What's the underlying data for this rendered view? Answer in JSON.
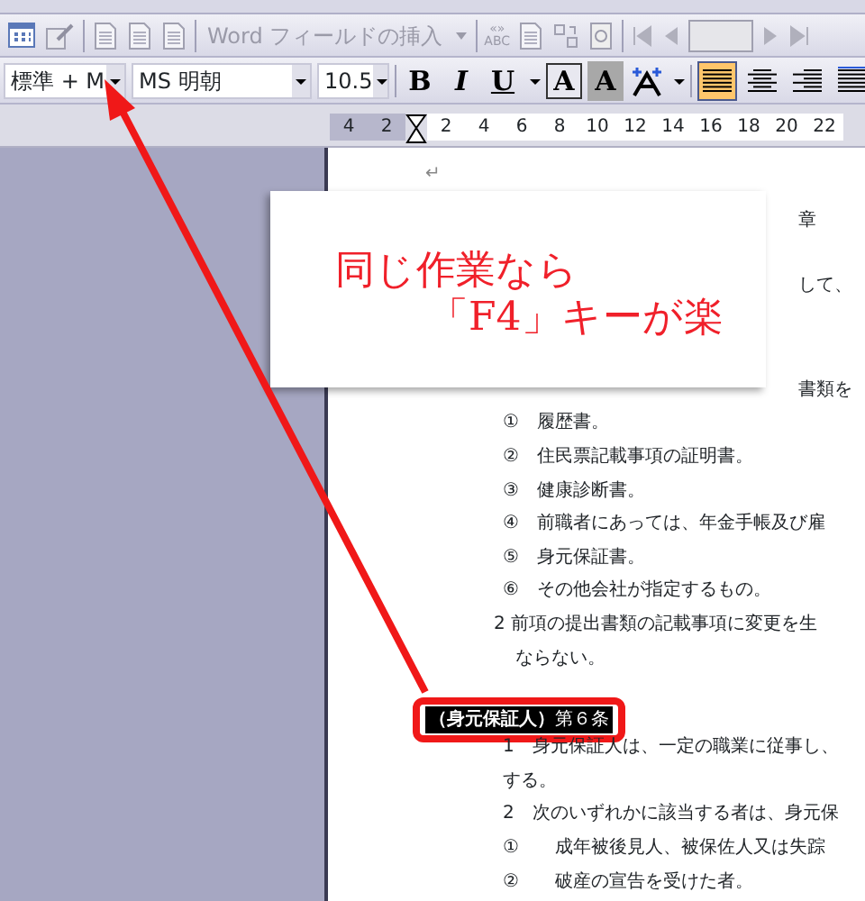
{
  "mail_merge_toolbar": {
    "field_menu": "Word フィールドの挿入",
    "merge_field_button": {
      "top": "«»",
      "bottom": "ABC"
    }
  },
  "formatting_toolbar": {
    "style": "標準 + M",
    "font": "MS 明朝",
    "size": "10.5",
    "format_buttons": [
      {
        "kind": "bold",
        "label": "B"
      },
      {
        "kind": "italic",
        "label": "I"
      },
      {
        "kind": "underline",
        "label": "U"
      },
      {
        "kind": "boxed",
        "label": "A"
      },
      {
        "kind": "shaded",
        "label": "A"
      }
    ],
    "alignment": [
      {
        "kind": "justify",
        "selected": true
      },
      {
        "kind": "center",
        "selected": false
      },
      {
        "kind": "right",
        "selected": false
      },
      {
        "kind": "distributed",
        "selected": false
      }
    ]
  },
  "ruler": {
    "left_labels": [
      "4",
      "2"
    ],
    "right_labels": [
      "2",
      "4",
      "6",
      "8",
      "10",
      "12",
      "14",
      "16",
      "18",
      "20",
      "22"
    ]
  },
  "document": {
    "lines": [
      {
        "kind": "mark",
        "text": "↵"
      },
      {
        "kind": "fragment",
        "text": "章"
      },
      {
        "kind": "fragment",
        "text": "して、"
      },
      {
        "kind": "fragment",
        "text": "書類を"
      },
      {
        "kind": "item",
        "text": "①　履歴書。"
      },
      {
        "kind": "item",
        "text": "②　住民票記載事項の証明書。"
      },
      {
        "kind": "item",
        "text": "③　健康診断書。"
      },
      {
        "kind": "item",
        "text": "④　前職者にあっては、年金手帳及び雇"
      },
      {
        "kind": "item",
        "text": "⑤　身元保証書。"
      },
      {
        "kind": "item",
        "text": "⑥　その他会社が指定するもの。"
      },
      {
        "kind": "clause",
        "text": "2 前項の提出書類の記載事項に変更を生"
      },
      {
        "kind": "continuation",
        "text": "ならない。"
      },
      {
        "kind": "heading",
        "text": "**（身元保証人）**第６条"
      },
      {
        "kind": "item",
        "text": "1　身元保証人は、一定の職業に従事し、"
      },
      {
        "kind": "item",
        "text": "する。"
      },
      {
        "kind": "item",
        "text": "2　次のいずれかに該当する者は、身元保"
      },
      {
        "kind": "item",
        "text": "①　　成年被後見人、被保佐人又は失踪"
      },
      {
        "kind": "item",
        "text": "②　　破産の宣告を受けた者。"
      }
    ]
  },
  "callout": {
    "lines": [
      "同じ作業なら",
      "「F4」キーが楽"
    ]
  }
}
